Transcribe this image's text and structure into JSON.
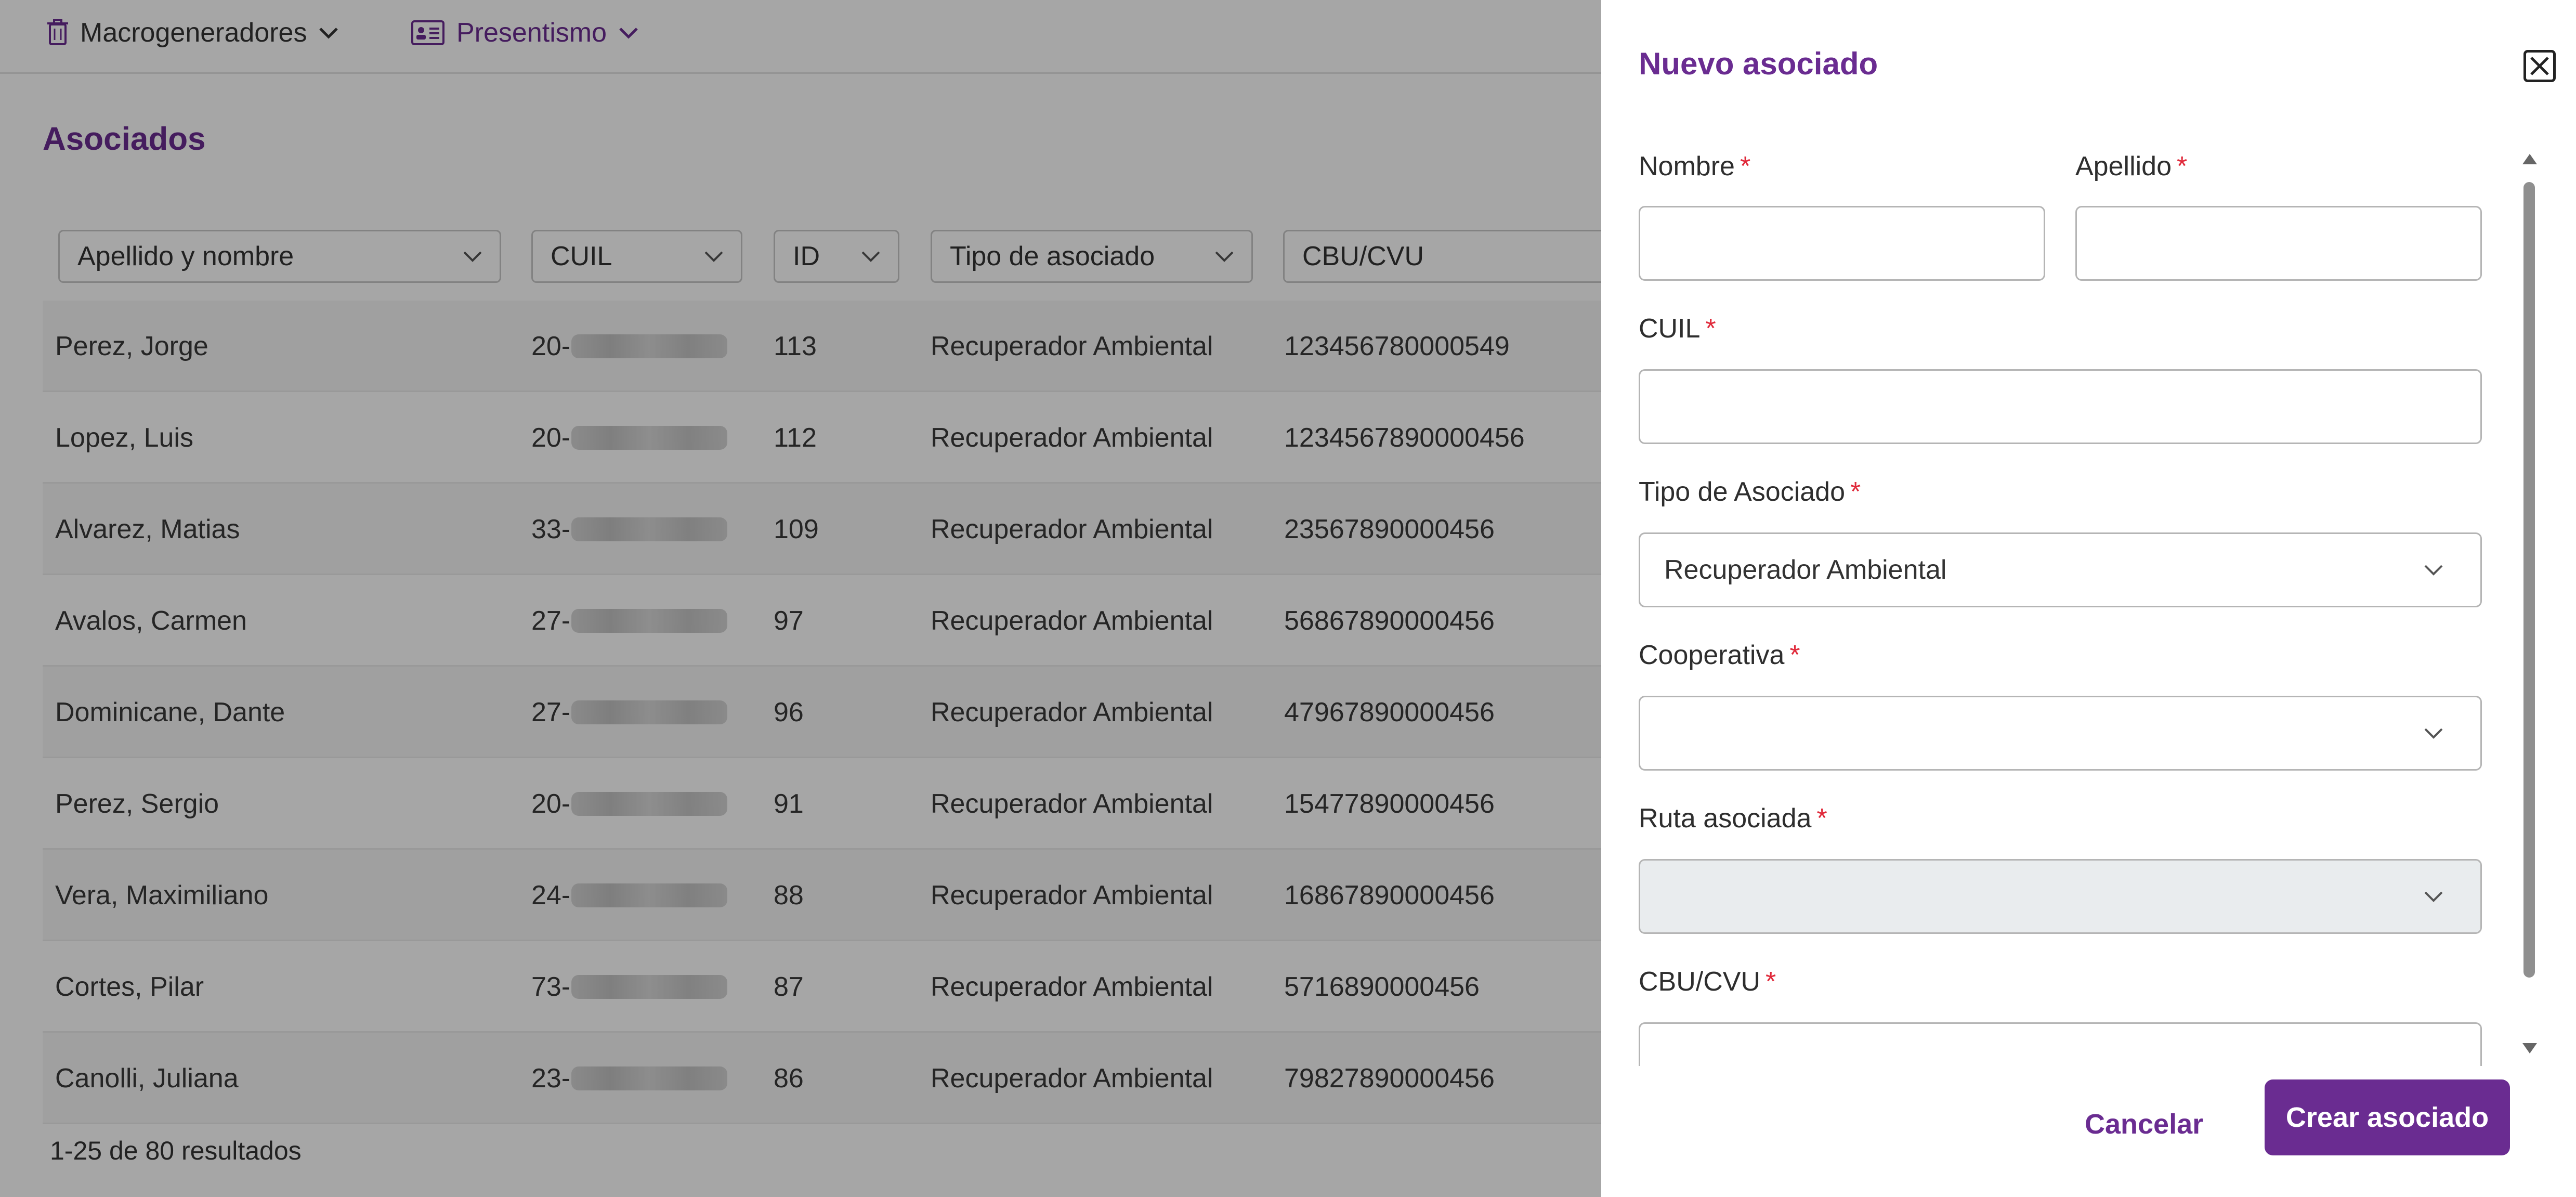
{
  "topnav": {
    "macro_label": "Macrogeneradores",
    "presentismo_label": "Presentismo"
  },
  "page": {
    "title": "Asociados",
    "results": "1-25 de 80 resultados"
  },
  "filters": {
    "nombre": "Apellido y nombre",
    "cuil": "CUIL",
    "id": "ID",
    "tipo": "Tipo de asociado",
    "cbu": "CBU/CVU"
  },
  "rows": [
    {
      "name": "Perez, Jorge",
      "cuil_prefix": "20-",
      "id": "113",
      "tipo": "Recuperador Ambiental",
      "cbu": "123456780000549"
    },
    {
      "name": "Lopez, Luis",
      "cuil_prefix": "20-",
      "id": "112",
      "tipo": "Recuperador Ambiental",
      "cbu": "1234567890000456"
    },
    {
      "name": "Alvarez, Matias",
      "cuil_prefix": "33-",
      "id": "109",
      "tipo": "Recuperador Ambiental",
      "cbu": "23567890000456"
    },
    {
      "name": "Avalos, Carmen",
      "cuil_prefix": "27-",
      "id": "97",
      "tipo": "Recuperador Ambiental",
      "cbu": "56867890000456"
    },
    {
      "name": "Dominicane, Dante",
      "cuil_prefix": "27-",
      "id": "96",
      "tipo": "Recuperador Ambiental",
      "cbu": "47967890000456"
    },
    {
      "name": "Perez, Sergio",
      "cuil_prefix": "20-",
      "id": "91",
      "tipo": "Recuperador Ambiental",
      "cbu": "15477890000456"
    },
    {
      "name": "Vera, Maximiliano",
      "cuil_prefix": "24-",
      "id": "88",
      "tipo": "Recuperador Ambiental",
      "cbu": "16867890000456"
    },
    {
      "name": "Cortes, Pilar",
      "cuil_prefix": "73-",
      "id": "87",
      "tipo": "Recuperador Ambiental",
      "cbu": "5716890000456"
    },
    {
      "name": "Canolli, Juliana",
      "cuil_prefix": "23-",
      "id": "86",
      "tipo": "Recuperador Ambiental",
      "cbu": "79827890000456"
    }
  ],
  "panel": {
    "title": "Nuevo asociado",
    "required_mark": "*",
    "nombre_label": "Nombre",
    "nombre_value": "",
    "apellido_label": "Apellido",
    "apellido_value": "",
    "cuil_label": "CUIL",
    "cuil_value": "",
    "tipo_label": "Tipo de Asociado",
    "tipo_value": "Recuperador Ambiental",
    "cooperativa_label": "Cooperativa",
    "cooperativa_value": "",
    "ruta_label": "Ruta asociada",
    "ruta_value": "",
    "cbu_label": "CBU/CVU",
    "cbu_value": "",
    "cancel_label": "Cancelar",
    "create_label": "Crear asociado"
  },
  "colors": {
    "brand_purple": "#6a2c91",
    "required_red": "#e0293a",
    "overlay": "rgba(0,0,0,0.35)",
    "disabled_bg": "#e9ecee"
  },
  "icons": {
    "macro": "trash-icon",
    "presentismo": "id-card-icon",
    "close": "close-icon",
    "dropdown": "chevron-down-icon"
  }
}
